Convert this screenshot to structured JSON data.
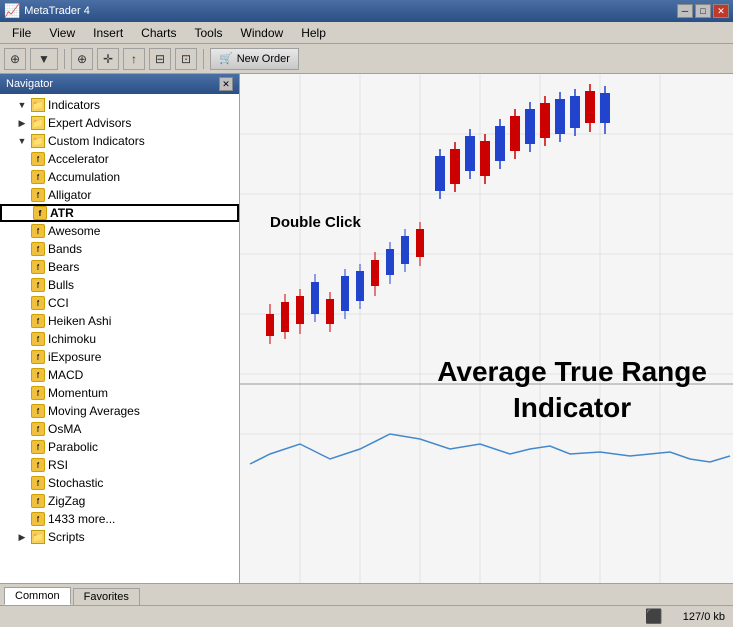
{
  "titlebar": {
    "title": "MetaTrader 4",
    "minimize": "─",
    "maximize": "□",
    "close": "✕"
  },
  "menubar": {
    "items": [
      "File",
      "View",
      "Insert",
      "Charts",
      "Tools",
      "Window",
      "Help"
    ]
  },
  "toolbar": {
    "new_order": "New Order"
  },
  "navigator": {
    "title": "Navigator",
    "close": "✕",
    "tree": [
      {
        "level": 1,
        "type": "root",
        "label": "Indicators",
        "expanded": true
      },
      {
        "level": 1,
        "type": "root",
        "label": "Expert Advisors",
        "expanded": false
      },
      {
        "level": 1,
        "type": "root",
        "label": "Custom Indicators",
        "expanded": true
      },
      {
        "level": 2,
        "type": "leaf",
        "label": "Accelerator"
      },
      {
        "level": 2,
        "type": "leaf",
        "label": "Accumulation"
      },
      {
        "level": 2,
        "type": "leaf",
        "label": "Alligator"
      },
      {
        "level": 2,
        "type": "leaf",
        "label": "ATR",
        "selected": true
      },
      {
        "level": 2,
        "type": "leaf",
        "label": "Awesome"
      },
      {
        "level": 2,
        "type": "leaf",
        "label": "Bands"
      },
      {
        "level": 2,
        "type": "leaf",
        "label": "Bears"
      },
      {
        "level": 2,
        "type": "leaf",
        "label": "Bulls"
      },
      {
        "level": 2,
        "type": "leaf",
        "label": "CCI"
      },
      {
        "level": 2,
        "type": "leaf",
        "label": "Heiken Ashi"
      },
      {
        "level": 2,
        "type": "leaf",
        "label": "Ichimoku"
      },
      {
        "level": 2,
        "type": "leaf",
        "label": "iExposure"
      },
      {
        "level": 2,
        "type": "leaf",
        "label": "MACD"
      },
      {
        "level": 2,
        "type": "leaf",
        "label": "Momentum"
      },
      {
        "level": 2,
        "type": "leaf",
        "label": "Moving Averages"
      },
      {
        "level": 2,
        "type": "leaf",
        "label": "OsMA"
      },
      {
        "level": 2,
        "type": "leaf",
        "label": "Parabolic"
      },
      {
        "level": 2,
        "type": "leaf",
        "label": "RSI"
      },
      {
        "level": 2,
        "type": "leaf",
        "label": "Stochastic"
      },
      {
        "level": 2,
        "type": "leaf",
        "label": "ZigZag"
      },
      {
        "level": 2,
        "type": "leaf",
        "label": "1433 more..."
      },
      {
        "level": 1,
        "type": "root",
        "label": "Scripts",
        "expanded": false
      }
    ]
  },
  "chart": {
    "dbl_click_label": "Double Click",
    "atr_label": "Average True Range\nIndicator"
  },
  "tabs": {
    "items": [
      "Common",
      "Favorites"
    ],
    "active": "Common"
  },
  "statusbar": {
    "memory": "127/0 kb"
  }
}
